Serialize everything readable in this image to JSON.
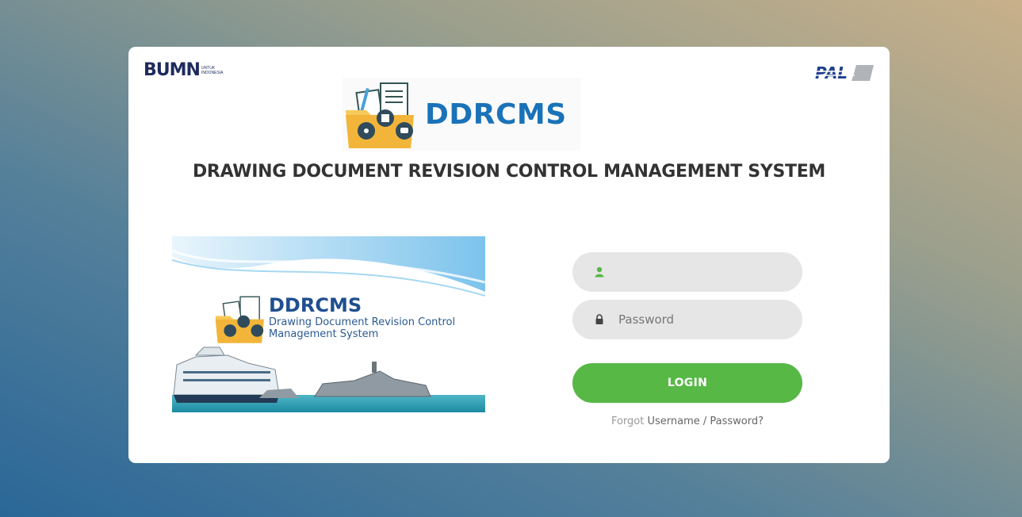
{
  "brand": {
    "bumn_word": "BUMN",
    "bumn_tagline": "UNTUK INDONESIA",
    "pal_word": "PAL",
    "app_logo_text": "DDRCMS"
  },
  "title": "DRAWING DOCUMENT REVISION CONTROL MANAGEMENT SYSTEM",
  "banner": {
    "name": "DDRCMS",
    "subtitle": "Drawing Document Revision Control Management System"
  },
  "form": {
    "username_placeholder": "",
    "password_placeholder": "Password",
    "login_label": "LOGIN",
    "forgot_prefix": "Forgot",
    "forgot_link": "Username / Password?"
  },
  "colors": {
    "accent": "#57b846",
    "brand_blue": "#1a72b8"
  },
  "icons": {
    "username_icon": "user-icon",
    "password_icon": "lock-icon"
  }
}
